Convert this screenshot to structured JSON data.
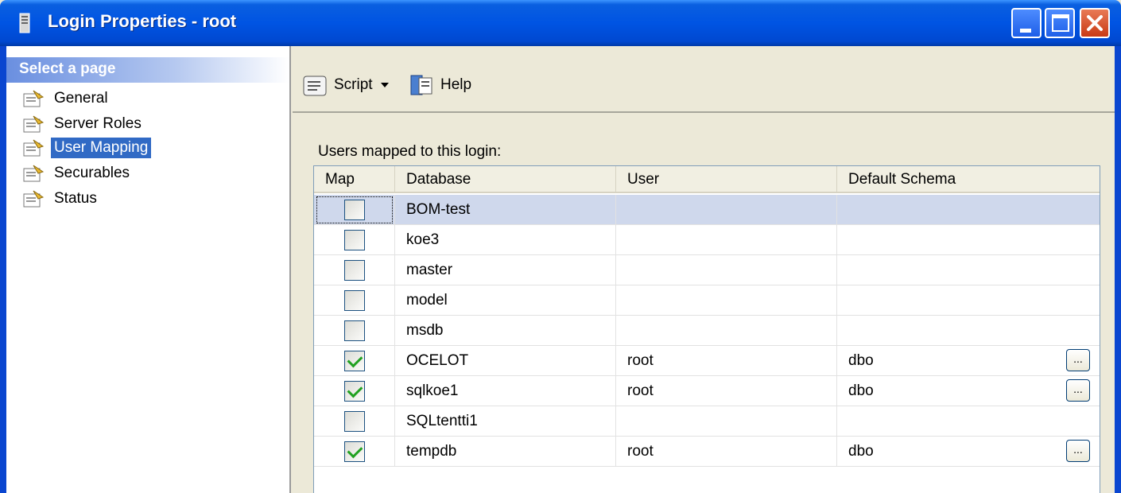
{
  "window": {
    "title": "Login Properties - root"
  },
  "sidebar": {
    "header": "Select a page",
    "items": [
      {
        "label": "General",
        "selected": false
      },
      {
        "label": "Server Roles",
        "selected": false
      },
      {
        "label": "User Mapping",
        "selected": true
      },
      {
        "label": "Securables",
        "selected": false
      },
      {
        "label": "Status",
        "selected": false
      }
    ]
  },
  "toolbar": {
    "script_label": "Script",
    "help_label": "Help"
  },
  "main": {
    "users_label": "Users mapped to this login:",
    "columns": [
      "Map",
      "Database",
      "User",
      "Default Schema"
    ],
    "rows": [
      {
        "map": false,
        "database": "BOM-test",
        "user": "",
        "schema": "",
        "selected": true
      },
      {
        "map": false,
        "database": "koe3",
        "user": "",
        "schema": ""
      },
      {
        "map": false,
        "database": "master",
        "user": "",
        "schema": ""
      },
      {
        "map": false,
        "database": "model",
        "user": "",
        "schema": ""
      },
      {
        "map": false,
        "database": "msdb",
        "user": "",
        "schema": ""
      },
      {
        "map": true,
        "database": "OCELOT",
        "user": "root",
        "schema": "dbo"
      },
      {
        "map": true,
        "database": "sqlkoe1",
        "user": "root",
        "schema": "dbo"
      },
      {
        "map": false,
        "database": "SQLtentti1",
        "user": "",
        "schema": ""
      },
      {
        "map": true,
        "database": "tempdb",
        "user": "root",
        "schema": "dbo"
      }
    ],
    "ellipsis_label": "..."
  },
  "colors": {
    "titlebar": "#0054e3",
    "selection": "#316ac5",
    "row_selected": "#cfd8ec",
    "check": "#21a121"
  },
  "icons": {
    "title": "server-icon",
    "nav": "properties-page-icon",
    "script": "script-icon",
    "help": "help-icon"
  }
}
